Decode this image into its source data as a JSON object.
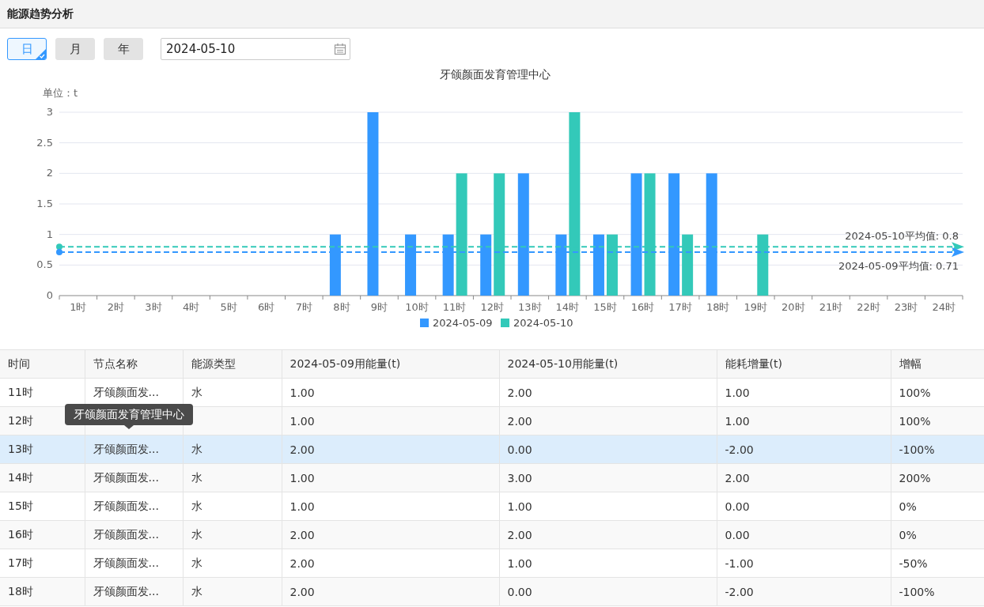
{
  "header": {
    "title": "能源趋势分析"
  },
  "period_tabs": [
    {
      "label": "日",
      "selected": true
    },
    {
      "label": "月",
      "selected": false
    },
    {
      "label": "年",
      "selected": false
    }
  ],
  "date_field": {
    "value": "2024-05-10"
  },
  "chart": {
    "chart_data": {
      "type": "bar",
      "title": "牙颌颜面发育管理中心",
      "ylabel": "单位：t",
      "categories": [
        "1时",
        "2时",
        "3时",
        "4时",
        "5时",
        "6时",
        "7时",
        "8时",
        "9时",
        "10时",
        "11时",
        "12时",
        "13时",
        "14时",
        "15时",
        "16时",
        "17时",
        "18时",
        "19时",
        "20时",
        "21时",
        "22时",
        "23时",
        "24时"
      ],
      "series": [
        {
          "name": "2024-05-09",
          "color": "#3398ff",
          "values": [
            0,
            0,
            0,
            0,
            0,
            0,
            0,
            1,
            3,
            1,
            1,
            1,
            2,
            1,
            1,
            2,
            2,
            2,
            0,
            0,
            0,
            0,
            0,
            0
          ]
        },
        {
          "name": "2024-05-10",
          "color": "#33c9b9",
          "values": [
            0,
            0,
            0,
            0,
            0,
            0,
            0,
            0,
            0,
            0,
            2,
            2,
            0,
            3,
            1,
            2,
            1,
            0,
            1,
            0,
            0,
            0,
            0,
            0
          ]
        }
      ],
      "ylim": [
        0,
        3
      ],
      "yticks": [
        0,
        0.5,
        1,
        1.5,
        2,
        2.5,
        3
      ],
      "grid": true,
      "legend": true,
      "ref_lines": [
        {
          "axis": "y",
          "value": 0.8,
          "label": "2024-05-10平均值: 0.8",
          "color": "#33c9b9"
        },
        {
          "axis": "y",
          "value": 0.71,
          "label": "2024-05-09平均值: 0.71",
          "color": "#3398ff"
        }
      ]
    }
  },
  "table": {
    "columns": [
      "时间",
      "节点名称",
      "能源类型",
      "2024-05-09用能量(t)",
      "2024-05-10用能量(t)",
      "能耗增量(t)",
      "增幅"
    ],
    "rows": [
      {
        "cells": [
          "11时",
          "牙颌颜面发...",
          "水",
          "1.00",
          "2.00",
          "1.00",
          "100%"
        ],
        "highlighted": false
      },
      {
        "cells": [
          "12时",
          "",
          "",
          "1.00",
          "2.00",
          "1.00",
          "100%"
        ],
        "highlighted": false
      },
      {
        "cells": [
          "13时",
          "牙颌颜面发...",
          "水",
          "2.00",
          "0.00",
          "-2.00",
          "-100%"
        ],
        "highlighted": true
      },
      {
        "cells": [
          "14时",
          "牙颌颜面发...",
          "水",
          "1.00",
          "3.00",
          "2.00",
          "200%"
        ],
        "highlighted": false
      },
      {
        "cells": [
          "15时",
          "牙颌颜面发...",
          "水",
          "1.00",
          "1.00",
          "0.00",
          "0%"
        ],
        "highlighted": false
      },
      {
        "cells": [
          "16时",
          "牙颌颜面发...",
          "水",
          "2.00",
          "2.00",
          "0.00",
          "0%"
        ],
        "highlighted": false
      },
      {
        "cells": [
          "17时",
          "牙颌颜面发...",
          "水",
          "2.00",
          "1.00",
          "-1.00",
          "-50%"
        ],
        "highlighted": false
      },
      {
        "cells": [
          "18时",
          "牙颌颜面发...",
          "水",
          "2.00",
          "0.00",
          "-2.00",
          "-100%"
        ],
        "highlighted": false
      }
    ],
    "tooltip": {
      "text": "牙颌颜面发育管理中心"
    }
  }
}
